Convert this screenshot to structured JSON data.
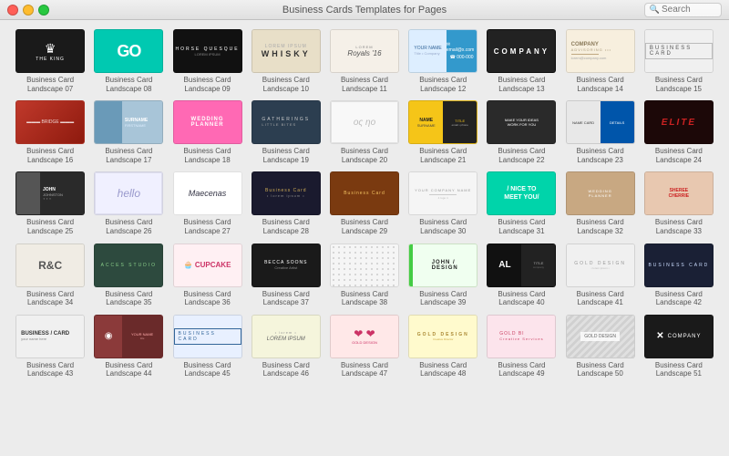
{
  "titlebar": {
    "title": "Business Cards Templates for Pages",
    "search_placeholder": "Search"
  },
  "cards": [
    {
      "id": "07",
      "label": "Business Card Landscape 07",
      "bg": "#1a1a1a",
      "text": "The King",
      "text_color": "#fff",
      "style": "crown"
    },
    {
      "id": "08",
      "label": "Business Card Landscape 08",
      "bg": "#00c9b1",
      "text": "GO",
      "text_color": "#fff",
      "style": "logo"
    },
    {
      "id": "09",
      "label": "Business Card Landscape 09",
      "bg": "#111",
      "text": "HORSE QUESQUE",
      "text_color": "#fff",
      "style": "text"
    },
    {
      "id": "10",
      "label": "Business Card Landscape 10",
      "bg": "#e8dfc8",
      "text": "WHISKY",
      "text_color": "#333",
      "style": "text"
    },
    {
      "id": "11",
      "label": "Business Card Landscape 11",
      "bg": "#f5f0e8",
      "text": "Royals '16",
      "text_color": "#333",
      "style": "text"
    },
    {
      "id": "12",
      "label": "Business Card Landscape 12",
      "bg": "#d8eeff",
      "text": "•••",
      "text_color": "#336699",
      "style": "dots"
    },
    {
      "id": "13",
      "label": "Business Card Landscape 13",
      "bg": "#111",
      "text": "COMPANY",
      "text_color": "#fff",
      "style": "text"
    },
    {
      "id": "14",
      "label": "Business Card Landscape 14",
      "bg": "#f7efde",
      "text": "COMPANY",
      "text_color": "#8a7a5a",
      "style": "serif"
    },
    {
      "id": "15",
      "label": "Business Card Landscape 15",
      "bg": "#f0f0f0",
      "text": "BUSINESS CARD",
      "text_color": "#555",
      "style": "plain"
    },
    {
      "id": "16",
      "label": "Business Card Landscape 16",
      "bg": "#c0392b",
      "text": "BRIDGE",
      "text_color": "#fff",
      "style": "photo"
    },
    {
      "id": "17",
      "label": "Business Card Landscape 17",
      "bg": "#a8c5d8",
      "text": "SURNAME",
      "text_color": "#fff",
      "style": "text"
    },
    {
      "id": "18",
      "label": "Business Card Landscape 18",
      "bg": "#ff69b4",
      "text": "WEDDING PLANNER",
      "text_color": "#fff",
      "style": "text"
    },
    {
      "id": "19",
      "label": "Business Card Landscape 19",
      "bg": "#2c3e50",
      "text": "GATHERINGS",
      "text_color": "#ccc",
      "style": "text"
    },
    {
      "id": "20",
      "label": "Business Card Landscape 20",
      "bg": "#f8f8f8",
      "text": "ος ηο",
      "text_color": "#aaa",
      "style": "minimal"
    },
    {
      "id": "21",
      "label": "Business Card Landscape 21",
      "bg": "#f5c518",
      "text": "NAME SURNAME",
      "text_color": "#222",
      "style": "yellow"
    },
    {
      "id": "22",
      "label": "Business Card Landscape 22",
      "bg": "#2a2a2a",
      "text": "MAKE YOUR IDEAS WORK FOR YOU",
      "text_color": "#fff",
      "style": "quote"
    },
    {
      "id": "23",
      "label": "Business Card Landscape 23",
      "bg": "#e8e8e8",
      "text": "□ □ □ □",
      "text_color": "#0055aa",
      "style": "boxes"
    },
    {
      "id": "24",
      "label": "Business Card Landscape 24",
      "bg": "#1c0808",
      "text": "ELITE",
      "text_color": "#cc2222",
      "style": "red-text"
    },
    {
      "id": "25",
      "label": "Business Card Landscape 25",
      "bg": "#2a2a2a",
      "text": "JOHN JOHNSTON",
      "text_color": "#fff",
      "style": "photo-dark"
    },
    {
      "id": "26",
      "label": "Business Card Landscape 26",
      "bg": "#f0f0ff",
      "text": "hello",
      "text_color": "#9999cc",
      "style": "hello"
    },
    {
      "id": "27",
      "label": "Business Card Landscape 27",
      "bg": "#ffffff",
      "text": "Maecenas",
      "text_color": "#334",
      "style": "script"
    },
    {
      "id": "28",
      "label": "Business Card Landscape 28",
      "bg": "#1a1a2e",
      "text": "Business Card",
      "text_color": "#ccaa55",
      "style": "gold"
    },
    {
      "id": "29",
      "label": "Business Card Landscape 29",
      "bg": "#7a3a10",
      "text": "Business Card",
      "text_color": "#f0c060",
      "style": "brown"
    },
    {
      "id": "30",
      "label": "Business Card Landscape 30",
      "bg": "#f5f5f5",
      "text": "YOUR COMPANY",
      "text_color": "#333",
      "style": "minimal2"
    },
    {
      "id": "31",
      "label": "Business Card Landscape 31",
      "bg": "#00d4aa",
      "text": "NICE TO MEET YOU",
      "text_color": "#fff",
      "style": "slogan"
    },
    {
      "id": "32",
      "label": "Business Card Landscape 32",
      "bg": "#c8a882",
      "text": "WEDDING PLANNER",
      "text_color": "#fff",
      "style": "wedding2"
    },
    {
      "id": "33",
      "label": "Business Card Landscape 33",
      "bg": "#e8c8b0",
      "text": "SHEREE CHERRIE",
      "text_color": "#cc2222",
      "style": "name"
    },
    {
      "id": "34",
      "label": "Business Card Landscape 34",
      "bg": "#f0ece4",
      "text": "R&C",
      "text_color": "#555",
      "style": "mono"
    },
    {
      "id": "35",
      "label": "Business Card Landscape 35",
      "bg": "#2d4a3e",
      "text": "ACCES STUDIO",
      "text_color": "#88cc88",
      "style": "dark-green"
    },
    {
      "id": "36",
      "label": "Business Card Landscape 36",
      "bg": "#fff0f3",
      "text": "CUPCAKE",
      "text_color": "#cc3366",
      "style": "cupcake"
    },
    {
      "id": "37",
      "label": "Business Card Landscape 37",
      "bg": "#1a1a1a",
      "text": "BECCA SOONS",
      "text_color": "#fff",
      "style": "dark-name"
    },
    {
      "id": "38",
      "label": "Business Card Landscape 38",
      "bg": "#f5f5f5",
      "text": "",
      "text_color": "#aaa",
      "style": "dots-pattern"
    },
    {
      "id": "39",
      "label": "Business Card Landscape 39",
      "bg": "#e8ffe0",
      "text": "JOHN / DESIGN",
      "text_color": "#222",
      "style": "green-line"
    },
    {
      "id": "40",
      "label": "Business Card Landscape 40",
      "bg": "#111",
      "text": "AL",
      "text_color": "#fff",
      "style": "initials"
    },
    {
      "id": "41",
      "label": "Business Card Landscape 41",
      "bg": "#f0f0f0",
      "text": "GOLD DESIGN",
      "text_color": "#888",
      "style": "light-gold"
    },
    {
      "id": "42",
      "label": "Business Card Landscape 42",
      "bg": "#1a2035",
      "text": "BUSINESS CARD",
      "text_color": "#ccddff",
      "style": "dark-blue"
    },
    {
      "id": "43",
      "label": "Business Card Landscape 43",
      "bg": "#f0f0f0",
      "text": "BUSINESS / CARD",
      "text_color": "#333",
      "style": "slash"
    },
    {
      "id": "44",
      "label": "Business Card Landscape 44",
      "bg": "#7a3030",
      "text": "",
      "text_color": "#fff",
      "style": "red-photo"
    },
    {
      "id": "45",
      "label": "Business Card Landscape 45",
      "bg": "#e8f0ff",
      "text": "BUSINESS CARD",
      "text_color": "#336699",
      "style": "blue-card"
    },
    {
      "id": "46",
      "label": "Business Card Landscape 46",
      "bg": "#f5f5dc",
      "text": "LOREM IPSUM",
      "text_color": "#666",
      "style": "beige"
    },
    {
      "id": "47",
      "label": "Business Card Landscape 47",
      "bg": "#ffe8e8",
      "text": "♥ ♥",
      "text_color": "#cc3366",
      "style": "hearts"
    },
    {
      "id": "48",
      "label": "Business Card Landscape 48",
      "bg": "#fffacd",
      "text": "GOLD DESIGN",
      "text_color": "#aa8833",
      "style": "gold2"
    },
    {
      "id": "49",
      "label": "Business Card Landscape 49",
      "bg": "#fce4ec",
      "text": "GOLD BIZ",
      "text_color": "#cc4466",
      "style": "pink-gold"
    },
    {
      "id": "50",
      "label": "Business Card Landscape 50",
      "bg": "#e8e8e8",
      "text": "GOLD DESIGN",
      "text_color": "#888",
      "style": "gray-geo"
    },
    {
      "id": "51",
      "label": "Business Card Landscape 51",
      "bg": "#1a1a1a",
      "text": "✕ COMPANY",
      "text_color": "#fff",
      "style": "x-company"
    }
  ]
}
